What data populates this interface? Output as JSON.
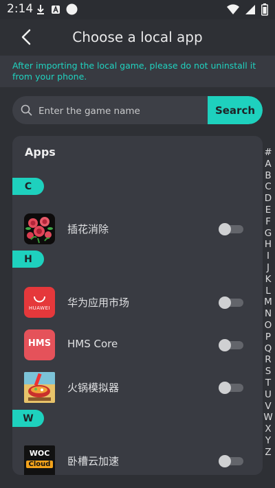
{
  "status_bar": {
    "time": "2:14"
  },
  "header": {
    "title": "Choose a local app"
  },
  "notice": {
    "text": "After importing the local game, please do not uninstall it from your phone."
  },
  "search": {
    "placeholder": "Enter the game name",
    "value": "",
    "button_label": "Search"
  },
  "apps_panel": {
    "title": "Apps",
    "sections": [
      {
        "letter": "C",
        "apps": [
          {
            "name": "插花消除",
            "icon": "flower-game-icon",
            "enabled": false
          }
        ]
      },
      {
        "letter": "H",
        "apps": [
          {
            "name": "华为应用市场",
            "icon": "huawei-appgallery-icon",
            "icon_text": "HUAWEI",
            "enabled": false
          },
          {
            "name": "HMS Core",
            "icon": "hms-core-icon",
            "icon_text": "HMS",
            "enabled": false
          },
          {
            "name": "火锅模拟器",
            "icon": "hotpot-simulator-icon",
            "enabled": false
          }
        ]
      },
      {
        "letter": "W",
        "apps": [
          {
            "name": "卧槽云加速",
            "icon": "woc-cloud-icon",
            "icon_text_top": "WOC",
            "icon_text_bottom": "Cloud",
            "enabled": false
          }
        ]
      }
    ]
  },
  "alpha_index": [
    "#",
    "A",
    "B",
    "C",
    "D",
    "E",
    "F",
    "G",
    "H",
    "I",
    "J",
    "K",
    "L",
    "M",
    "N",
    "O",
    "P",
    "Q",
    "R",
    "S",
    "T",
    "U",
    "V",
    "W",
    "X",
    "Y",
    "Z"
  ],
  "colors": {
    "accent": "#1ed1be",
    "background": "#2e3035",
    "panel": "#393b42",
    "huawei_red": "#e5383b"
  }
}
